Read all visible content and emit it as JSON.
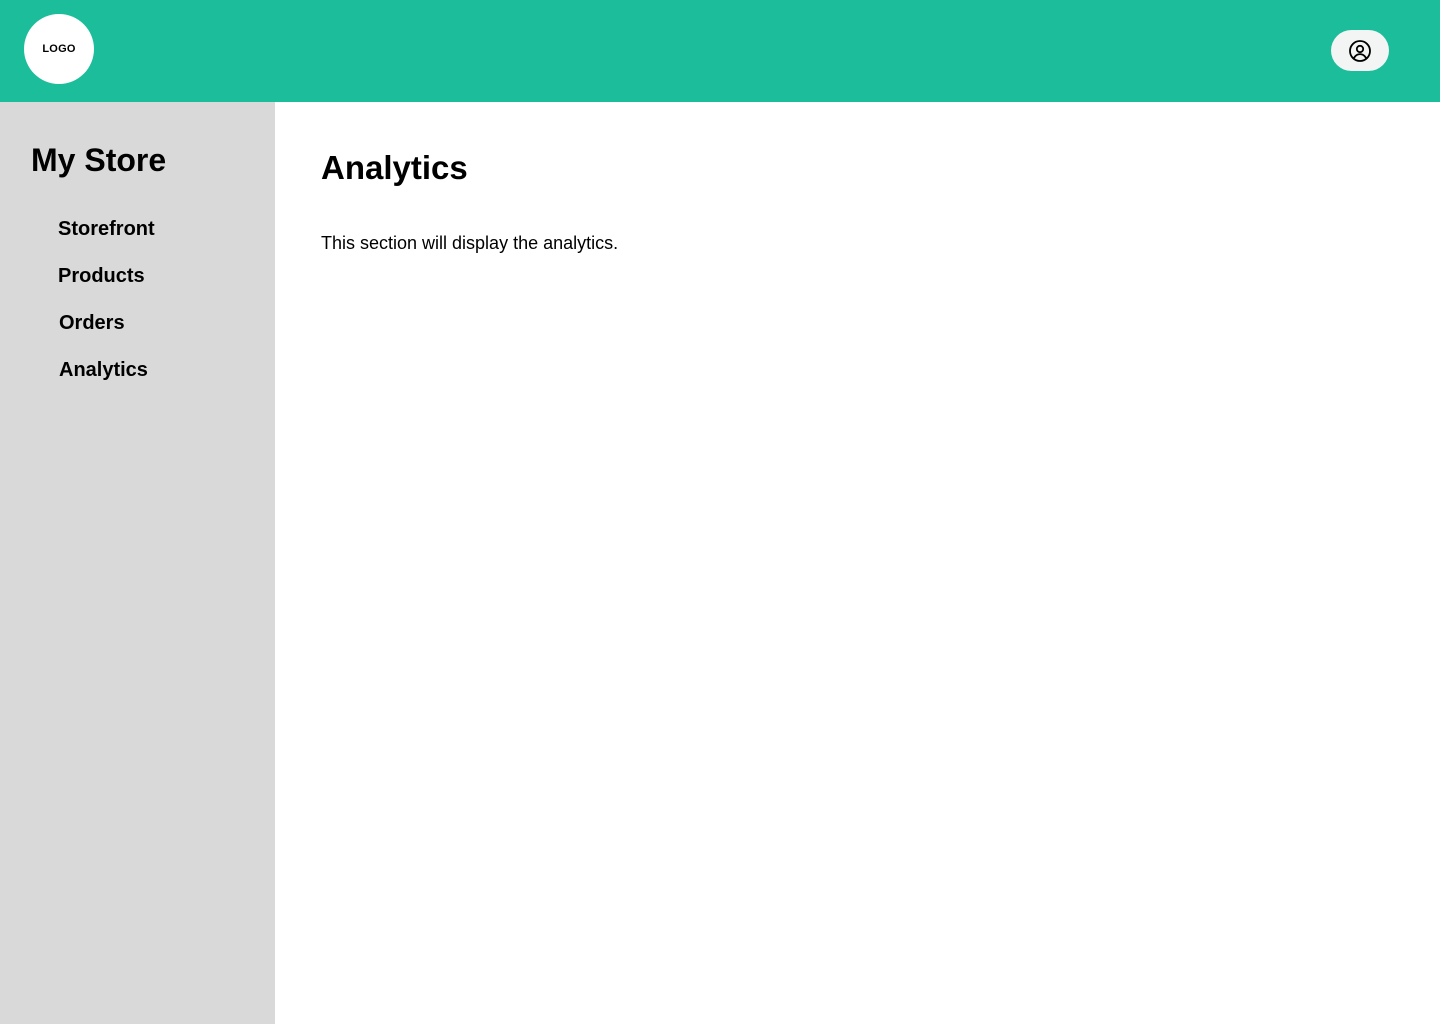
{
  "header": {
    "logo_text": "LOGO",
    "background_color": "#1cbd9b",
    "user_icon": "user-circle-icon"
  },
  "sidebar": {
    "title": "My Store",
    "background_color": "#d9d9d9",
    "items": [
      {
        "label": "Storefront"
      },
      {
        "label": "Products"
      },
      {
        "label": "Orders"
      },
      {
        "label": "Analytics"
      }
    ]
  },
  "main": {
    "title": "Analytics",
    "description": "This section will display the analytics."
  }
}
